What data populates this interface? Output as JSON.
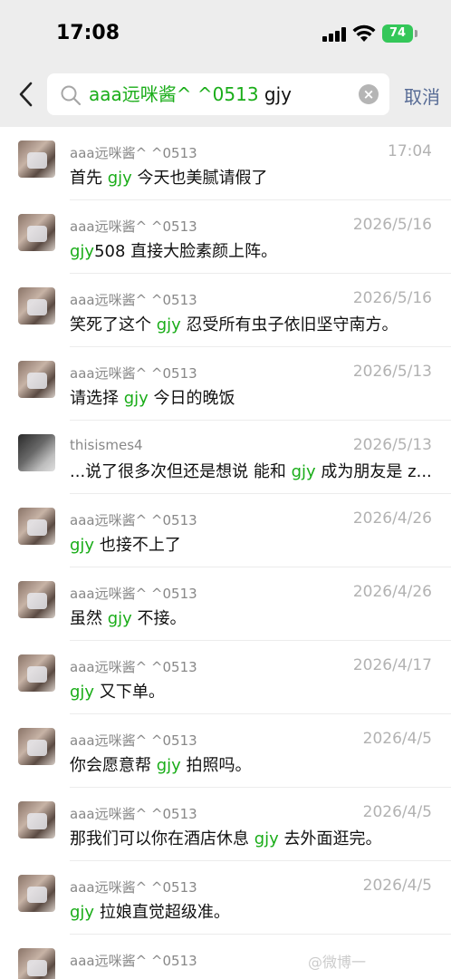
{
  "status": {
    "time": "17:08",
    "battery": "74"
  },
  "search": {
    "query_highlight": "aaa远咪酱^ ^0513",
    "query_rest": " gjy",
    "cancel_label": "取消"
  },
  "results": [
    {
      "sender": "aaa远咪酱^ ^0513",
      "date": "17:04",
      "pre": "首先 ",
      "hl": "gjy",
      "post": " 今天也美腻请假了"
    },
    {
      "sender": "aaa远咪酱^ ^0513",
      "date": "2026/5/16",
      "pre": "",
      "hl": "gjy",
      "post": "508 直接大脸素颜上阵。"
    },
    {
      "sender": "aaa远咪酱^ ^0513",
      "date": "2026/5/16",
      "pre": "笑死了这个 ",
      "hl": "gjy",
      "post": " 忍受所有虫子依旧坚守南方。"
    },
    {
      "sender": "aaa远咪酱^ ^0513",
      "date": "2026/5/13",
      "pre": "请选择 ",
      "hl": "gjy",
      "post": " 今日的晚饭"
    },
    {
      "sender": "thisismes4",
      "date": "2026/5/13",
      "pre": "...说了很多次但还是想说 能和 ",
      "hl": "gjy",
      "post": " 成为朋友是 z..."
    },
    {
      "sender": "aaa远咪酱^ ^0513",
      "date": "2026/4/26",
      "pre": "",
      "hl": "gjy",
      "post": " 也接不上了"
    },
    {
      "sender": "aaa远咪酱^ ^0513",
      "date": "2026/4/26",
      "pre": "虽然 ",
      "hl": "gjy",
      "post": " 不接。"
    },
    {
      "sender": "aaa远咪酱^ ^0513",
      "date": "2026/4/17",
      "pre": "",
      "hl": "gjy",
      "post": " 又下单。"
    },
    {
      "sender": "aaa远咪酱^ ^0513",
      "date": "2026/4/5",
      "pre": "你会愿意帮 ",
      "hl": "gjy",
      "post": " 拍照吗。"
    },
    {
      "sender": "aaa远咪酱^ ^0513",
      "date": "2026/4/5",
      "pre": "那我们可以你在酒店休息 ",
      "hl": "gjy",
      "post": " 去外面逛完。"
    },
    {
      "sender": "aaa远咪酱^ ^0513",
      "date": "2026/4/5",
      "pre": "",
      "hl": "gjy",
      "post": " 拉娘直觉超级准。"
    },
    {
      "sender": "aaa远咪酱^ ^0513",
      "date": "",
      "pre": "",
      "hl": "",
      "post": ""
    }
  ],
  "watermark": "@微博一"
}
